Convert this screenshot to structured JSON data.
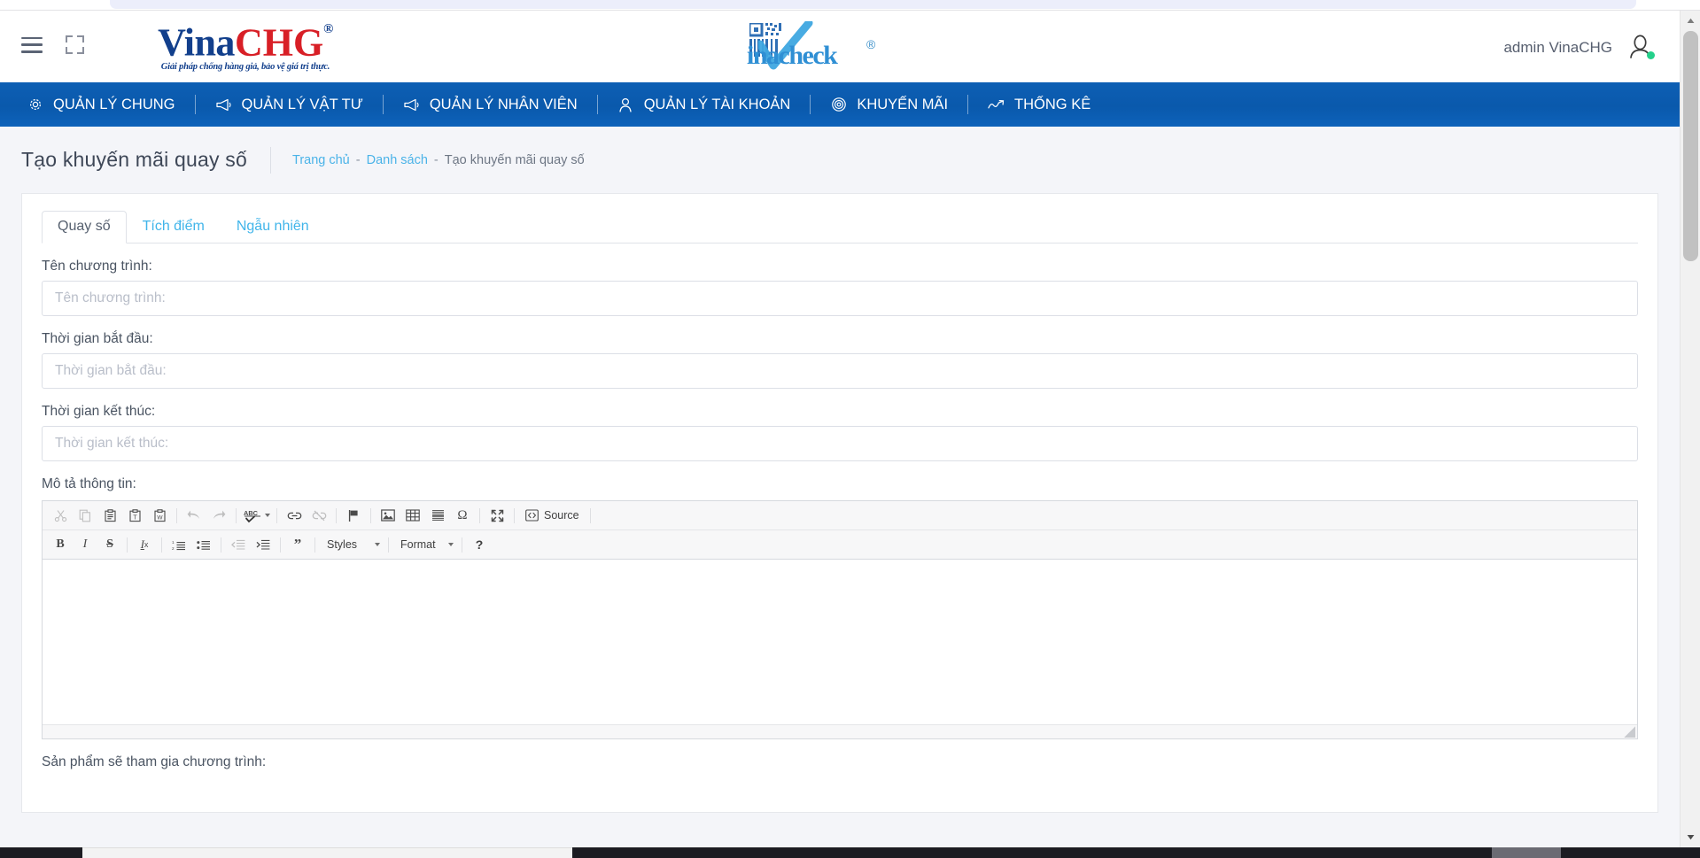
{
  "header": {
    "menu_icon": "hamburger-menu-icon",
    "expand_icon": "fullscreen-expand-icon",
    "logo_primary": {
      "text_blue": "Vina",
      "text_red": "CHG",
      "reg": "®",
      "tagline": "Giải pháp chống hàng giả, bảo vệ giá trị thực."
    },
    "logo_secondary": {
      "word": "inacheck",
      "reg": "®"
    },
    "user_name": "admin VinaCHG",
    "avatar_icon": "user-avatar-icon",
    "status": "online"
  },
  "nav": {
    "items": [
      {
        "label": "QUẢN LÝ CHUNG",
        "icon": "gear-icon"
      },
      {
        "label": "QUẢN LÝ VẬT TƯ",
        "icon": "megaphone-icon"
      },
      {
        "label": "QUẢN LÝ NHÂN VIÊN",
        "icon": "megaphone-icon"
      },
      {
        "label": "QUẢN LÝ TÀI KHOẢN",
        "icon": "user-icon"
      },
      {
        "label": "KHUYẾN MÃI",
        "icon": "bullseye-icon"
      },
      {
        "label": "THỐNG KÊ",
        "icon": "chart-trend-icon"
      }
    ]
  },
  "page": {
    "title": "Tạo khuyến mãi quay số",
    "breadcrumb": [
      {
        "label": "Trang chủ",
        "link": true
      },
      {
        "label": "-",
        "sep": true
      },
      {
        "label": "Danh sách",
        "link": true
      },
      {
        "label": "-",
        "sep": true
      },
      {
        "label": "Tạo khuyến mãi quay số",
        "link": false
      }
    ]
  },
  "tabs": [
    {
      "label": "Quay số",
      "active": true
    },
    {
      "label": "Tích điểm",
      "active": false
    },
    {
      "label": "Ngẫu nhiên",
      "active": false
    }
  ],
  "form": {
    "program_name": {
      "label": "Tên chương trình:",
      "placeholder": "Tên chương trình:",
      "value": ""
    },
    "start_time": {
      "label": "Thời gian bắt đầu:",
      "placeholder": "Thời gian bắt đầu:",
      "value": ""
    },
    "end_time": {
      "label": "Thời gian kết thúc:",
      "placeholder": "Thời gian kết thúc:",
      "value": ""
    },
    "description": {
      "label": "Mô tả thông tin:",
      "content": ""
    },
    "products": {
      "label": "Sản phẩm sẽ tham gia chương trình:"
    }
  },
  "editor": {
    "row1": [
      {
        "name": "cut-icon",
        "glyph": "✂"
      },
      {
        "name": "copy-icon",
        "glyph": "⧉"
      },
      {
        "name": "paste-icon",
        "glyph": "📋"
      },
      {
        "name": "paste-text-icon",
        "glyph": "T"
      },
      {
        "name": "paste-word-icon",
        "glyph": "W"
      },
      {
        "name": "undo-icon",
        "glyph": "↩"
      },
      {
        "name": "redo-icon",
        "glyph": "↪"
      },
      {
        "name": "spellcheck-icon",
        "glyph": "ABC"
      },
      {
        "name": "link-icon",
        "glyph": "🔗"
      },
      {
        "name": "unlink-icon",
        "glyph": "⛓"
      },
      {
        "name": "anchor-flag-icon",
        "glyph": "⚑"
      },
      {
        "name": "image-icon",
        "glyph": "🖼"
      },
      {
        "name": "table-icon",
        "glyph": "▦"
      },
      {
        "name": "horizontal-rule-icon",
        "glyph": "≡"
      },
      {
        "name": "special-character-icon",
        "glyph": "Ω"
      },
      {
        "name": "maximize-icon",
        "glyph": "⤢"
      }
    ],
    "source_label": "Source",
    "row2": [
      {
        "name": "bold-icon",
        "glyph": "B"
      },
      {
        "name": "italic-icon",
        "glyph": "I"
      },
      {
        "name": "strikethrough-icon",
        "glyph": "S"
      },
      {
        "name": "remove-format-icon",
        "glyph": "Tx"
      },
      {
        "name": "numbered-list-icon",
        "glyph": "1≡"
      },
      {
        "name": "bulleted-list-icon",
        "glyph": "•≡"
      },
      {
        "name": "outdent-icon",
        "glyph": "⇤"
      },
      {
        "name": "indent-icon",
        "glyph": "⇥"
      },
      {
        "name": "blockquote-icon",
        "glyph": "❞"
      }
    ],
    "styles_label": "Styles",
    "format_label": "Format",
    "about_label": "?"
  },
  "colors": {
    "nav_blue": "#0a59ac",
    "link_blue": "#41b5ea",
    "title_gray": "#3e4757",
    "logo_blue": "#123f8c",
    "logo_red": "#d81f26",
    "online_green": "#24d08a"
  }
}
